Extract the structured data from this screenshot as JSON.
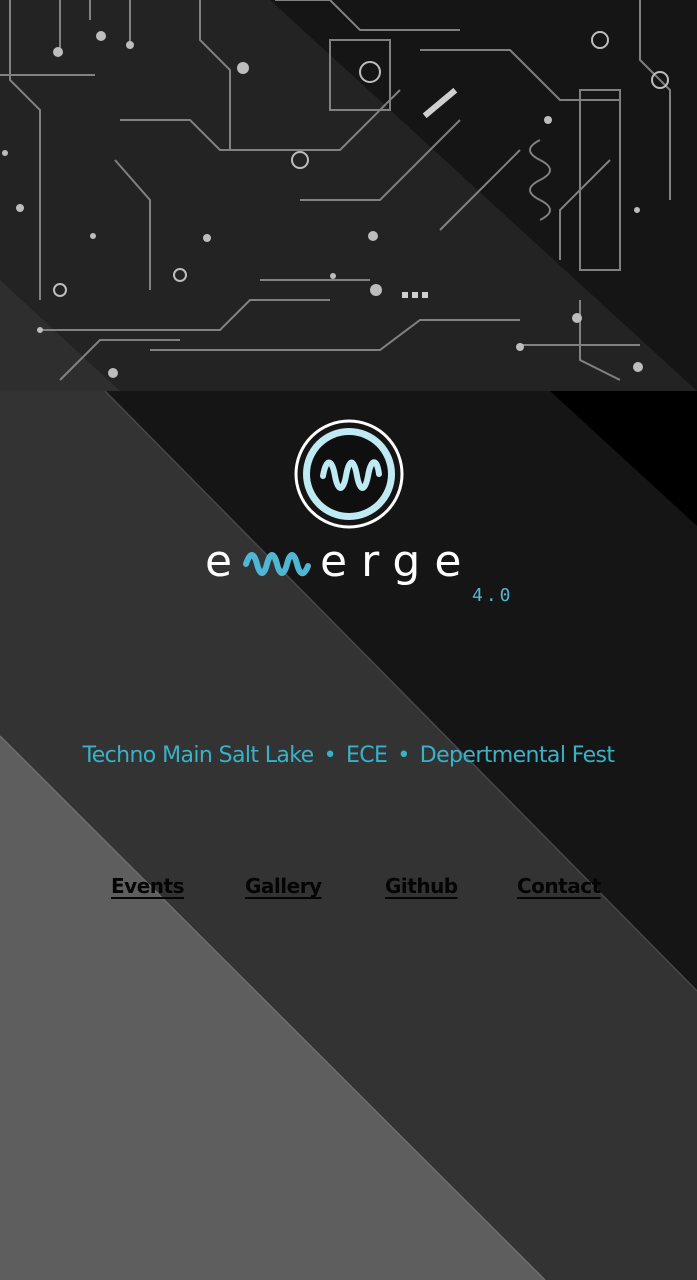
{
  "brand": {
    "name_part1": "e",
    "name_part3": "erge",
    "version": "4.0",
    "accent_color": "#4fb6d4",
    "logo_icon": "wave-circle-logo-icon"
  },
  "tagline": {
    "college": "Techno Main Salt Lake",
    "separator": "•",
    "department": "ECE",
    "event": "Depertmental Fest",
    "color": "#37b2c9"
  },
  "nav": {
    "items": [
      {
        "label": "Events"
      },
      {
        "label": "Gallery"
      },
      {
        "label": "Github"
      },
      {
        "label": "Contact"
      }
    ]
  }
}
